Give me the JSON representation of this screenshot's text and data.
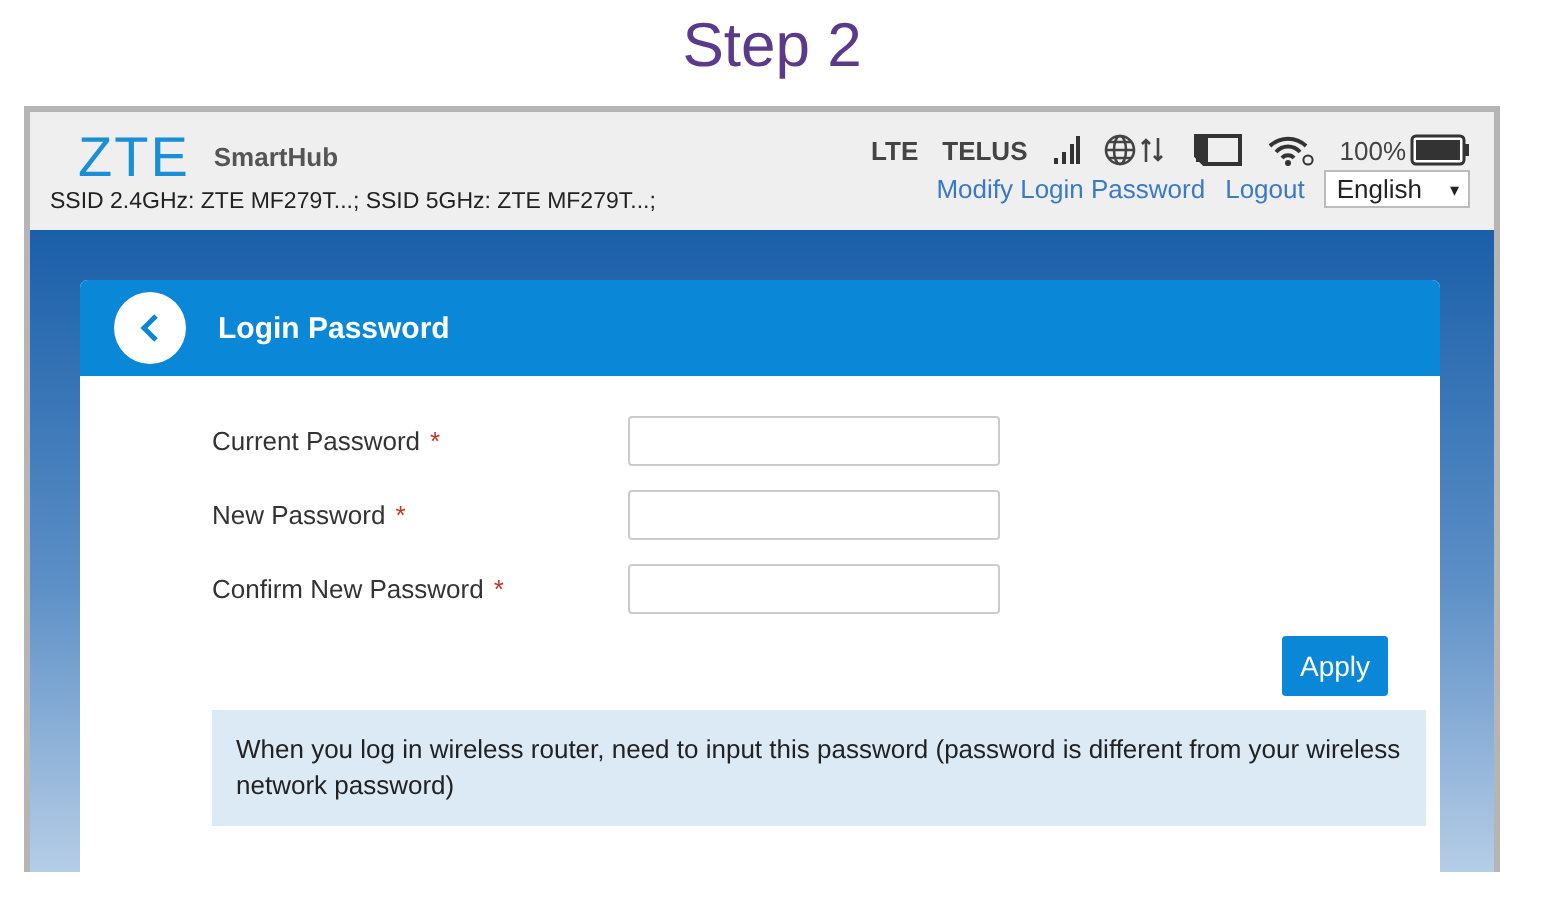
{
  "caption": "Step 2",
  "header": {
    "logo": "ZTE",
    "product": "SmartHub",
    "ssid_info": "SSID 2.4GHz: ZTE MF279T...; SSID 5GHz: ZTE MF279T...;",
    "network_type": "LTE",
    "carrier": "TELUS",
    "battery": "100%",
    "links": [
      {
        "label": "Modify Login Password"
      },
      {
        "label": "Logout"
      }
    ],
    "language": {
      "value": "English",
      "arrow": "▾"
    }
  },
  "panel": {
    "title": "Login Password",
    "fields": [
      {
        "label": "Current Password",
        "required_mark": "*"
      },
      {
        "label": "New Password",
        "required_mark": "*"
      },
      {
        "label": "Confirm New Password",
        "required_mark": "*"
      }
    ],
    "apply_button": "Apply",
    "note": "When you log in wireless router, need to input this password (password is different from your wireless network password)"
  }
}
